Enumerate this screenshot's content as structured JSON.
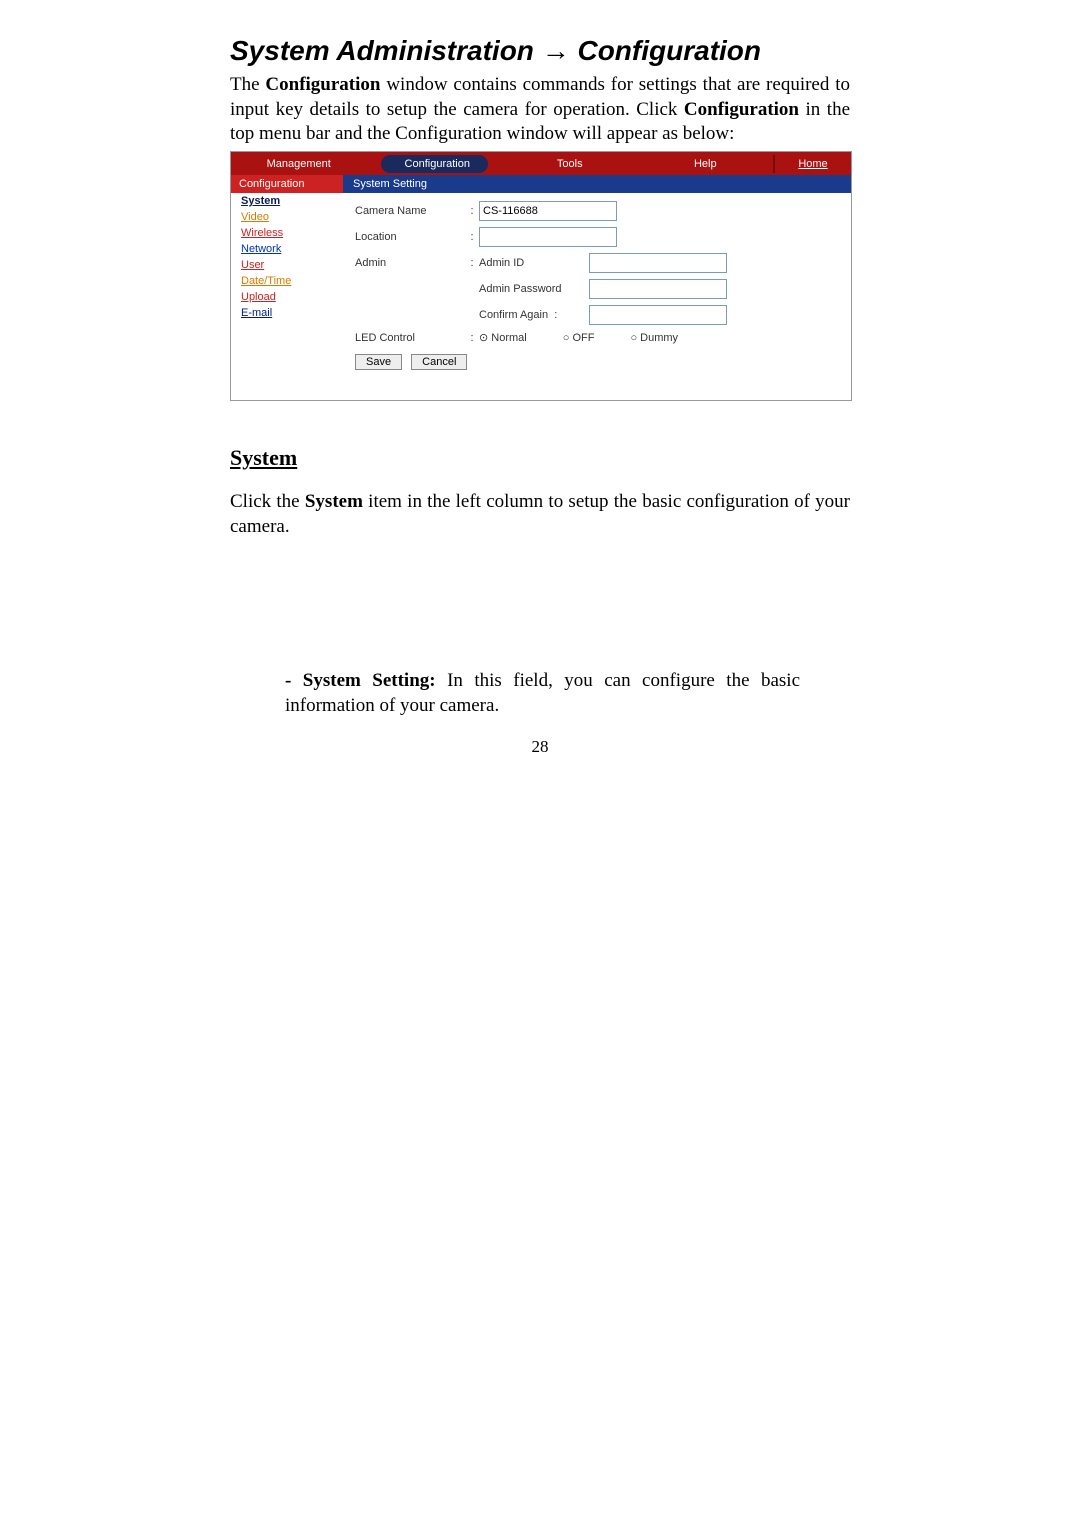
{
  "title_left": "System Administration",
  "title_arrow": "→",
  "title_right": "Configuration",
  "intro_p1a": "The ",
  "intro_p1b": "Configuration",
  "intro_p1c": " window contains commands for settings that are required to input key details to setup the camera for operation. Click ",
  "intro_p1d": "Configuration",
  "intro_p1e": " in the top menu bar and the Configuration window will appear as below:",
  "shot": {
    "top": {
      "management": "Management",
      "configuration": "Configuration",
      "tools": "Tools",
      "help": "Help",
      "home": "Home"
    },
    "sidebar": {
      "head": "Configuration",
      "items": [
        "System",
        "Video",
        "Wireless",
        "Network",
        "User",
        "Date/Time",
        "Upload",
        "E-mail"
      ]
    },
    "main": {
      "head": "System Setting",
      "camera_name_label": "Camera Name",
      "camera_name_value": "CS-116688",
      "location_label": "Location",
      "location_value": "",
      "admin_label": "Admin",
      "admin_id_label": "Admin ID",
      "admin_pw_label": "Admin Password",
      "confirm_label": "Confirm Again",
      "led_label": "LED Control",
      "led_opts": [
        "Normal",
        "OFF",
        "Dummy"
      ],
      "save": "Save",
      "cancel": "Cancel"
    }
  },
  "section_head": "System",
  "section_p_a": "Click the ",
  "section_p_b": "System",
  "section_p_c": " item in the left column to setup the basic configuration of your camera.",
  "bullet_a": "- System Setting:",
  "bullet_b": " In this field, you can configure the basic information of your camera.",
  "page_number": "28"
}
